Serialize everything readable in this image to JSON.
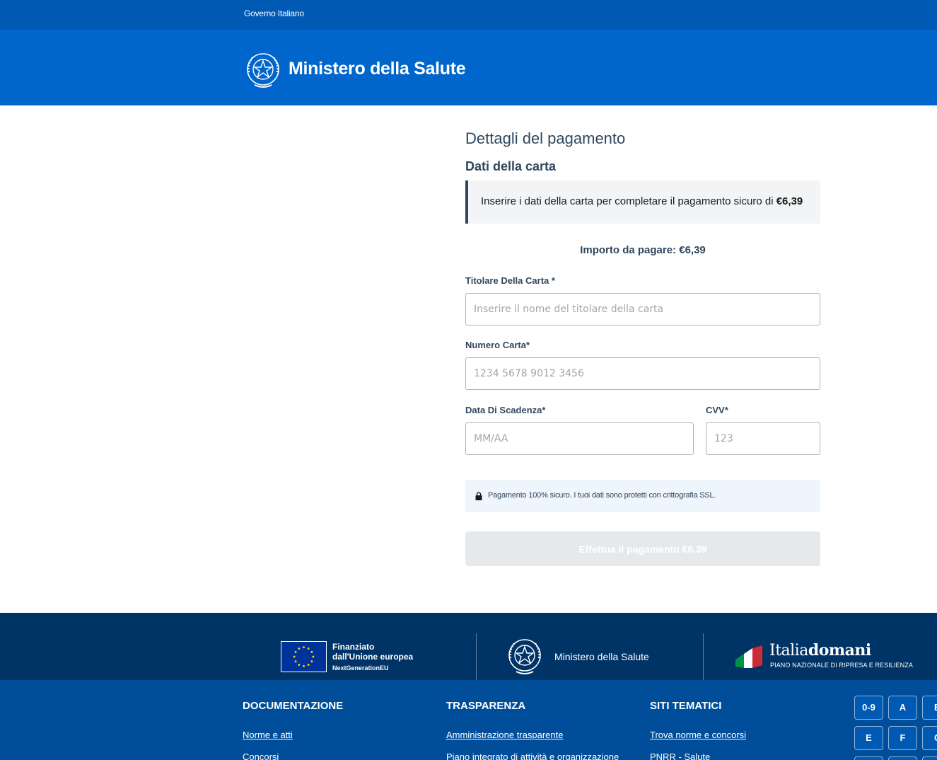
{
  "slim_header": {
    "gov_link": "Governo Italiano"
  },
  "header": {
    "site_title": "Ministero della Salute"
  },
  "payment": {
    "title": "Dettagli del pagamento",
    "subtitle": "Dati della carta",
    "callout_text": "Inserire i dati della carta per completare il pagamento sicuro di ",
    "callout_amount": "€6,39",
    "amount_line": "Importo da pagare: €6,39",
    "fields": {
      "holder": {
        "label": "Titolare Della Carta *",
        "placeholder": "Inserire il nome del titolare della carta",
        "value": ""
      },
      "number": {
        "label": "Numero Carta*",
        "placeholder": "1234 5678 9012 3456",
        "value": ""
      },
      "expiry": {
        "label": "Data Di Scadenza*",
        "placeholder": "MM/AA",
        "value": ""
      },
      "cvv": {
        "label": "CVV*",
        "placeholder": "123",
        "value": ""
      }
    },
    "secure_note": "Pagamento 100% sicuro. I tuoi dati sono protetti con crittografia SSL.",
    "submit_label": "Effettua il pagamento €6,39",
    "submit_enabled": false
  },
  "partners": {
    "eu": {
      "line1": "Finanziato",
      "line2": "dall'Unione europea",
      "line3": "NextGenerationEU"
    },
    "ministry": "Ministero della Salute",
    "italiadomani": {
      "part1": "Italia",
      "part2": "domani",
      "subtitle": "PIANO NAZIONALE DI RIPRESA E RESILIENZA"
    }
  },
  "footer": {
    "columns": [
      {
        "title": "DOCUMENTAZIONE",
        "links": [
          "Norme e atti",
          "Concorsi"
        ]
      },
      {
        "title": "TRASPARENZA",
        "links": [
          "Amministrazione trasparente",
          "Piano integrato di attività e organizzazione"
        ]
      },
      {
        "title": "SITI TEMATICI",
        "links": [
          "Trova norme e concorsi",
          "PNRR - Salute"
        ]
      }
    ],
    "az_index": [
      "0-9",
      "A",
      "B",
      "E",
      "F",
      "G"
    ]
  },
  "colors": {
    "slim_header": "#0059b3",
    "header": "#0066cc",
    "partner_band": "#003366",
    "footer": "#004d99",
    "button_disabled": "#e6e9ec"
  },
  "icons": [
    "emblem-icon",
    "lock-icon",
    "eu-flag-icon",
    "italia-flag-icon"
  ]
}
